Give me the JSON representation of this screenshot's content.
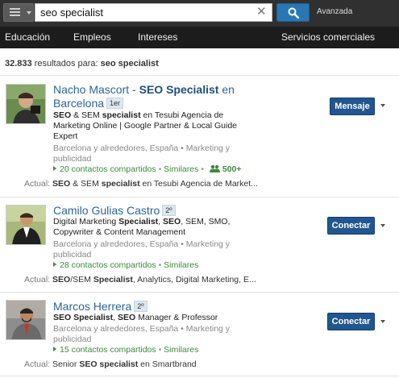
{
  "search": {
    "query": "seo specialist",
    "clear_icon": "close-icon",
    "advanced_label": "Avanzada"
  },
  "nav": {
    "items": [
      "Educación",
      "Empleos",
      "Intereses",
      "Servicios comerciales"
    ]
  },
  "results_summary": {
    "count": "32.833",
    "label": "resultados para:",
    "query": "seo specialist"
  },
  "results": [
    {
      "name": "Nacho Mascort",
      "name_suffix_pre": " - ",
      "name_highlight": "SEO Specialist",
      "name_suffix_post": " en",
      "name_line2": "Barcelona",
      "degree": "1er",
      "headline": [
        "SEO",
        " & SEM ",
        "specialist",
        " en Tesubi Agencia de"
      ],
      "headline_2": "Marketing Online | Google Partner & Local Guide",
      "headline_3": "Expert",
      "location_1": "Barcelona y alrededores, España • Marketing y",
      "location_2": "publicidad",
      "shared": "20 contactos compartidos",
      "similar": "Similares",
      "group_count": "500+",
      "current_label": "Actual:",
      "current": [
        "SEO",
        " & SEM ",
        "specialist",
        " en Tesubi Agencia de Market..."
      ],
      "action": "Mensaje"
    },
    {
      "name": "Camilo Gulias Castro",
      "degree": "2º",
      "headline": [
        "Digital Marketing ",
        "Specialist",
        ", ",
        "SEO",
        ", SEM, SMO,"
      ],
      "headline_2": "Copywriter & Content Management",
      "location_1": "Barcelona y alrededores, España • Marketing y",
      "location_2": "publicidad",
      "shared": "28 contactos compartidos",
      "similar": "Similares",
      "current_label": "Actual:",
      "current": [
        "SEO",
        "/SEM ",
        "Specialist",
        ", Analytics, Digital Marketing, E..."
      ],
      "action": "Conectar"
    },
    {
      "name": "Marcos Herrera",
      "degree": "2º",
      "headline": [
        "SEO Specialist",
        ", ",
        "SEO",
        " Manager & Professor"
      ],
      "location_1": "Barcelona y alrededores, España • Marketing y",
      "location_2": "publicidad",
      "shared": "15 contactos compartidos",
      "similar": "Similares",
      "current_label": "Actual:",
      "current": [
        "Senior ",
        "SEO specialist",
        " en Smartbrand"
      ],
      "action": "Conectar"
    }
  ],
  "colors": {
    "topbar": "#303030",
    "navbar": "#1c1c1c",
    "primary_button": "#22568f",
    "link": "#2a6496",
    "shared_green": "#3d8a3d"
  }
}
